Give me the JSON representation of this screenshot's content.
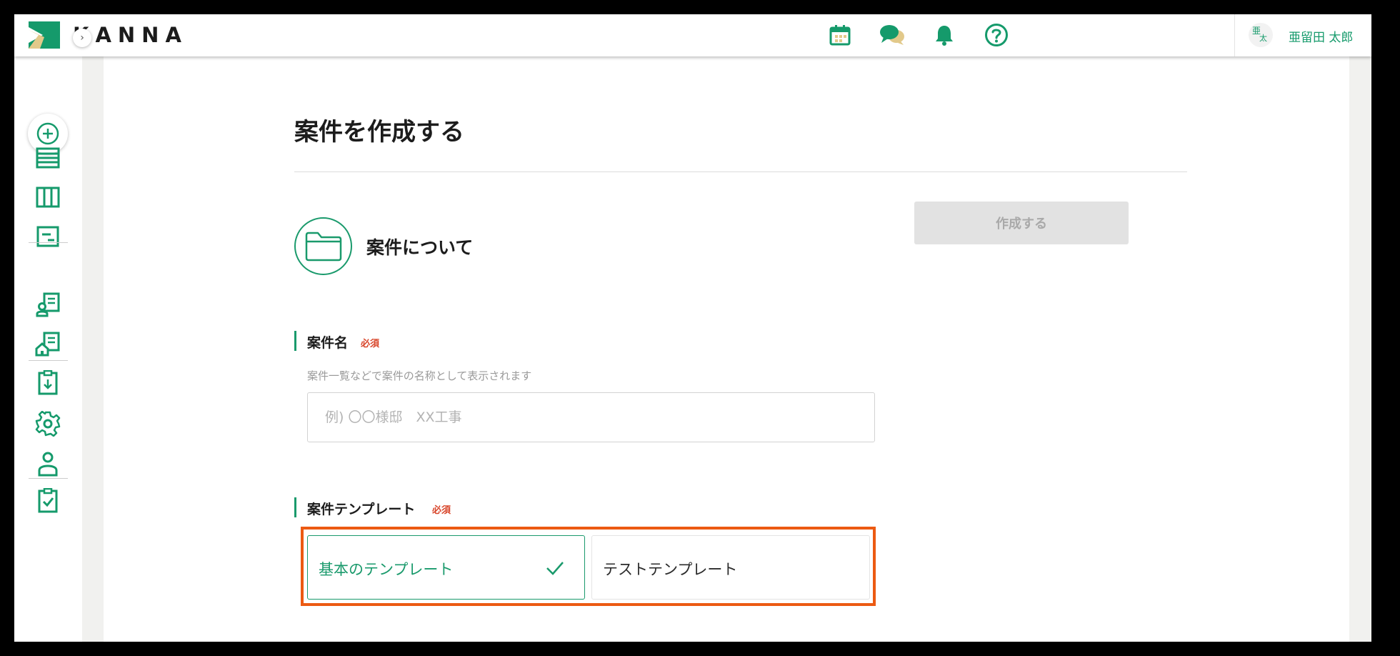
{
  "header": {
    "brand": "KANNA",
    "user": {
      "avatar_top": "亜",
      "avatar_bottom": "太",
      "name": "亜留田 太郎"
    },
    "icons": [
      "calendar-icon",
      "chat-icon",
      "bell-icon",
      "help-icon"
    ]
  },
  "sidebar": {
    "toggle": "›",
    "items": [
      "add-icon",
      "list-icon",
      "board-icon",
      "report-icon",
      "client-icon",
      "property-icon",
      "download-icon",
      "settings-icon",
      "user-icon",
      "task-icon"
    ]
  },
  "main": {
    "title": "案件を作成する",
    "create_button": "作成する",
    "section_title": "案件について",
    "name_field": {
      "label": "案件名",
      "required": "必須",
      "help": "案件一覧などで案件の名称として表示されます",
      "placeholder": "例) 〇〇様邸　XX工事",
      "value": ""
    },
    "template_field": {
      "label": "案件テンプレート",
      "required": "必須",
      "options": [
        {
          "label": "基本のテンプレート",
          "selected": true
        },
        {
          "label": "テストテンプレート",
          "selected": false
        }
      ]
    }
  },
  "colors": {
    "accent": "#1a9a6c",
    "required": "#d8452a",
    "highlight": "#ec5a12"
  }
}
